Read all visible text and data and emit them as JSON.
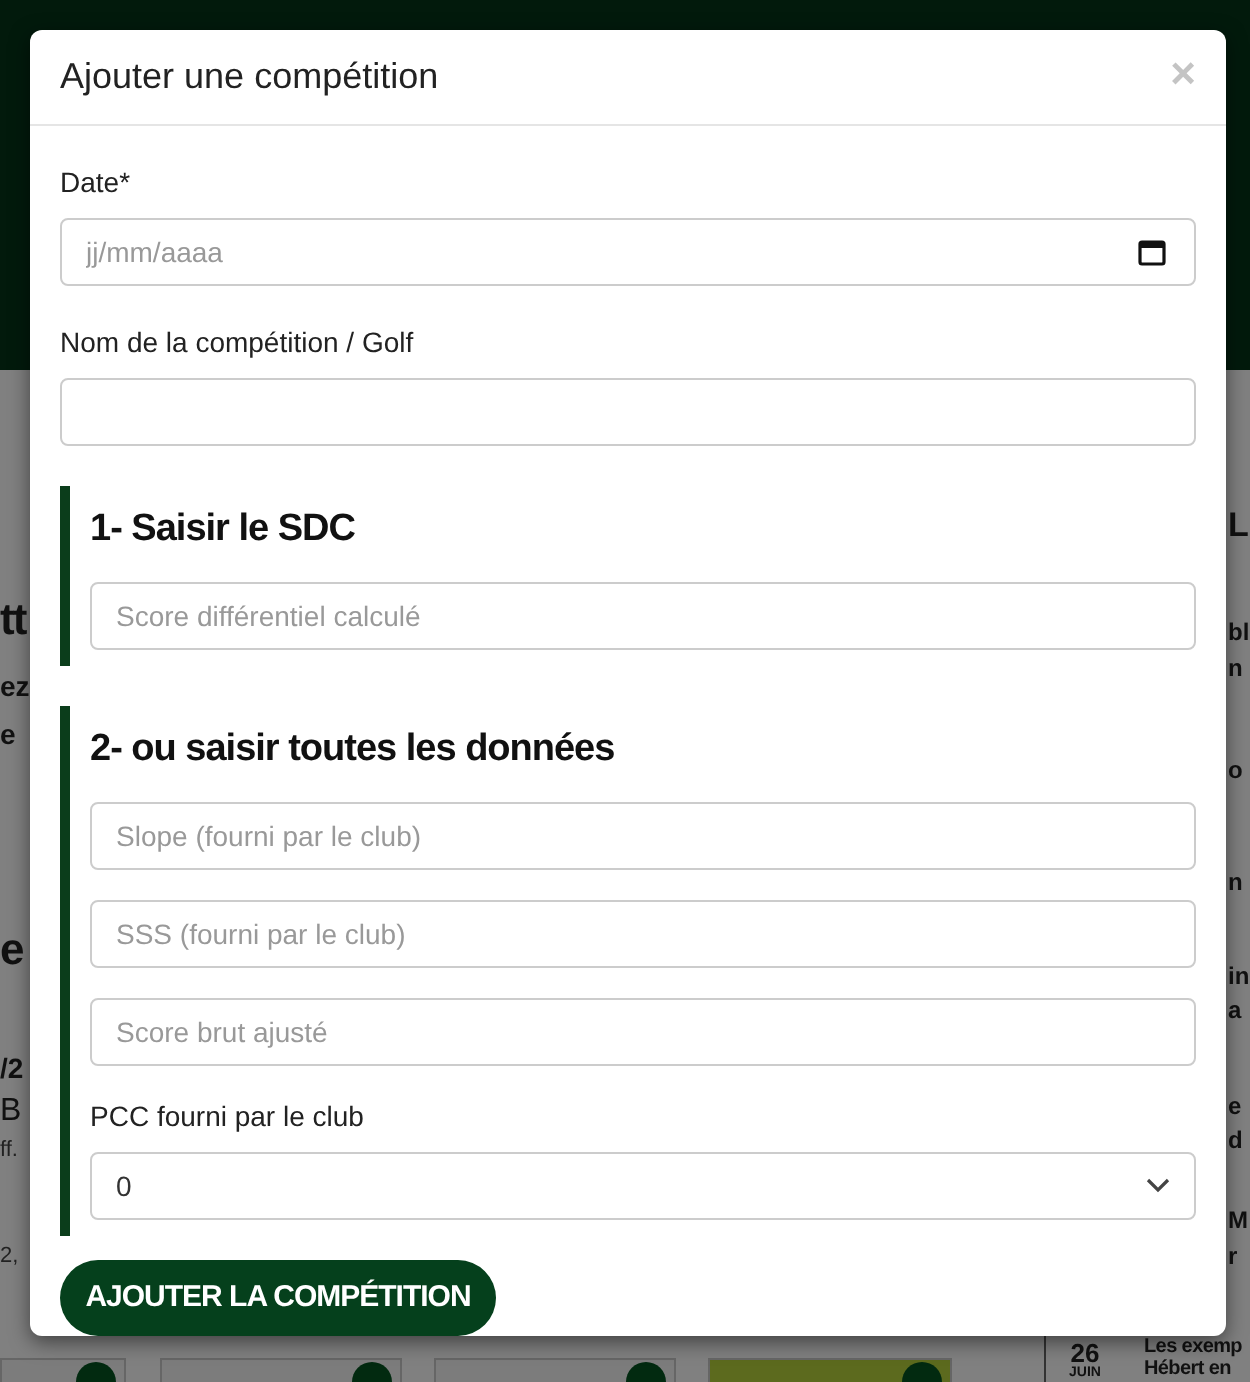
{
  "background": {
    "left_fragments": [
      {
        "text": "tt",
        "kind": "heading"
      },
      {
        "text": "ez",
        "kind": "bold"
      },
      {
        "text": "e",
        "kind": "bold"
      },
      {
        "text": "e",
        "kind": "heading"
      },
      {
        "text": "/2",
        "kind": "bold"
      },
      {
        "text": "B",
        "kind": "text"
      },
      {
        "text": "ff.",
        "kind": "small"
      },
      {
        "text": "2,",
        "kind": "small"
      }
    ],
    "right_fragments": [
      {
        "text": "L",
        "kind": "heading"
      },
      {
        "text": "bl",
        "kind": "bold"
      },
      {
        "text": "n",
        "kind": "bold"
      },
      {
        "text": "o",
        "kind": "bold"
      },
      {
        "text": "n",
        "kind": "bold"
      },
      {
        "text": "in",
        "kind": "bold"
      },
      {
        "text": "a",
        "kind": "bold"
      },
      {
        "text": "e",
        "kind": "bold"
      },
      {
        "text": "d",
        "kind": "bold"
      },
      {
        "text": "M",
        "kind": "bold"
      },
      {
        "text": "r",
        "kind": "bold"
      }
    ],
    "cards": [
      {
        "highlighted": false
      },
      {
        "highlighted": false
      },
      {
        "highlighted": false
      },
      {
        "highlighted": true
      }
    ],
    "date_badge": {
      "day": "26",
      "month": "JUIN"
    },
    "news_lines": [
      "Les exemp",
      "Hébert en"
    ]
  },
  "modal": {
    "title": "Ajouter une compétition",
    "close": "×",
    "fields": [
      {
        "label": "Date*",
        "placeholder": "jj/mm/aaaa",
        "kind": "date"
      },
      {
        "label": "Nom de la compétition / Golf",
        "kind": "text"
      }
    ],
    "sections": [
      {
        "heading": "1- Saisir le SDC",
        "fields": [
          {
            "kind": "text",
            "placeholder": "Score différentiel calculé"
          }
        ]
      },
      {
        "heading": "2- ou saisir toutes les données",
        "fields": [
          {
            "kind": "text",
            "placeholder": "Slope (fourni par le club)"
          },
          {
            "kind": "text",
            "placeholder": "SSS (fourni par le club)"
          },
          {
            "kind": "text",
            "placeholder": "Score brut ajusté"
          },
          {
            "kind": "select",
            "label": "PCC fourni par le club",
            "value": "0"
          }
        ]
      }
    ],
    "submit": "AJOUTER LA COMPÉTITION"
  }
}
